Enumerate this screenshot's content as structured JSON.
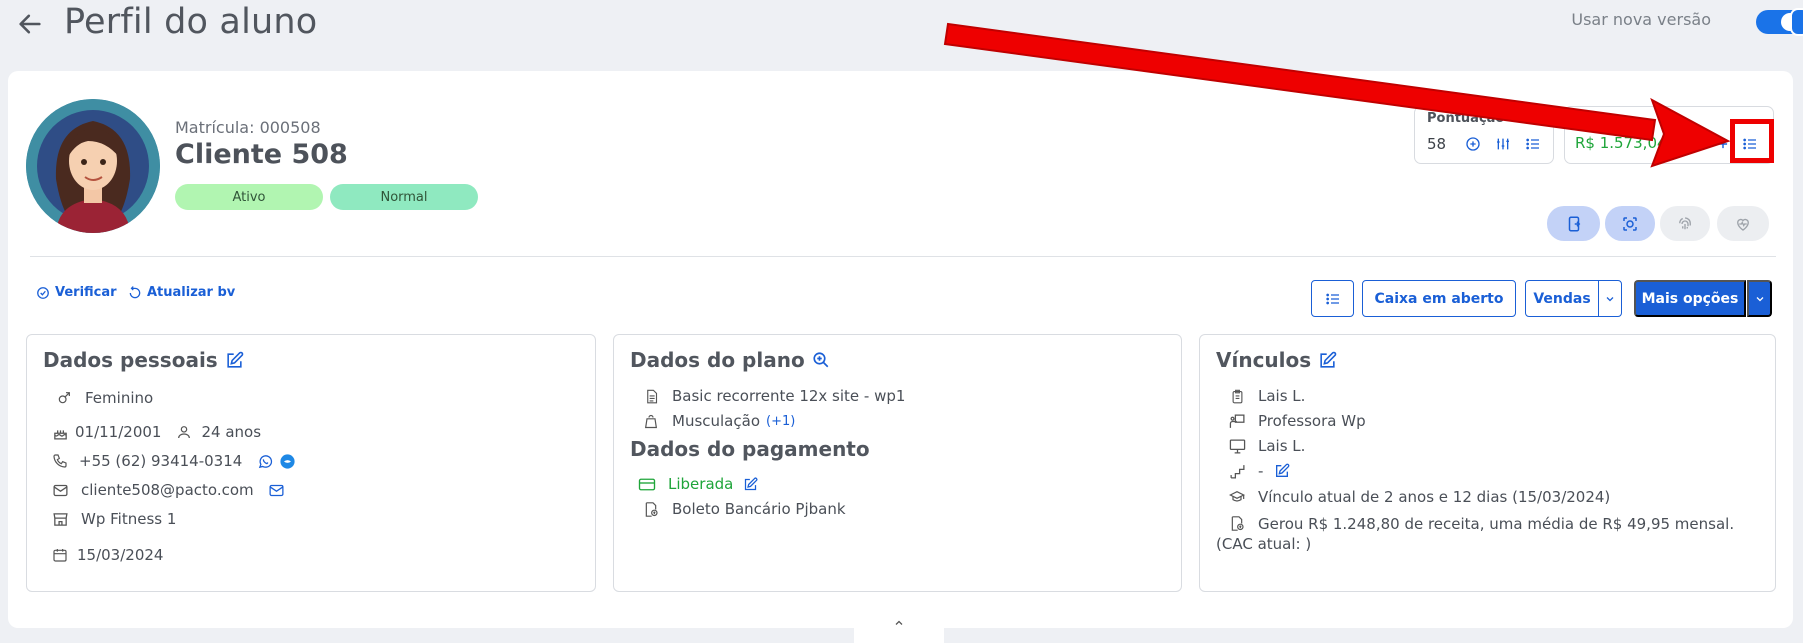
{
  "header": {
    "title": "Perfil do aluno",
    "new_version_label": "Usar nova versão"
  },
  "student": {
    "matricula": "Matrícula: 000508",
    "name": "Cliente 508",
    "status_badge": "Ativo",
    "type_badge": "Normal"
  },
  "score": {
    "label": "Pontuação",
    "value": "58"
  },
  "saldo": {
    "value": "R$ 1.573,04"
  },
  "actions": {
    "verify": "Verificar",
    "update_bv": "Atualizar bv",
    "open_cash": "Caixa em aberto",
    "sales": "Vendas",
    "more_options": "Mais opções"
  },
  "personal": {
    "title": "Dados pessoais",
    "gender": "Feminino",
    "birthdate": "01/11/2001",
    "age": "24 anos",
    "phone": "+55 (62) 93414-0314",
    "email": "cliente508@pacto.com",
    "unit": "Wp Fitness 1",
    "date": "15/03/2024"
  },
  "plan": {
    "title": "Dados do plano",
    "plan_name": "Basic recorrente 12x site - wp1",
    "modality": "Musculação",
    "modality_extra": "(+1)",
    "payment_title": "Dados do pagamento",
    "payment_status": "Liberada",
    "payment_method": "Boleto Bancário Pjbank"
  },
  "links": {
    "title": "Vínculos",
    "consultant": "Lais L.",
    "teacher": "Professora Wp",
    "trainer": "Lais L.",
    "level": "-",
    "current_link": "Vínculo atual de 2 anos e 12 dias (15/03/2024)",
    "revenue": "Gerou R$ 1.248,80 de receita, uma média de R$ 49,95 mensal. (CAC atual: )"
  },
  "colors": {
    "primary": "#1a5fd6",
    "success": "#1fa53a",
    "annotation": "#ee0000"
  }
}
